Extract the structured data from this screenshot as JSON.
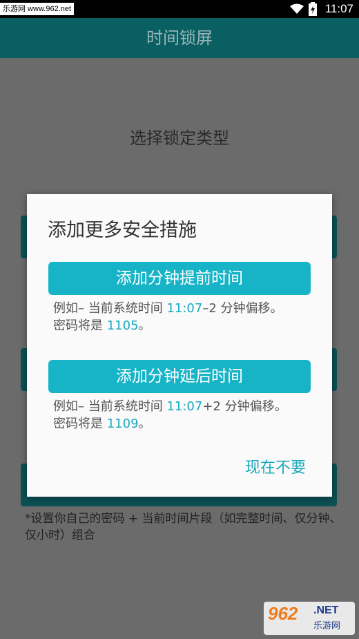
{
  "status_bar": {
    "watermark": "乐游网 www.962.net",
    "time": "11:07"
  },
  "app_bar": {
    "title": "时间锁屏"
  },
  "screen": {
    "title": "选择锁定类型",
    "footnote": "*设置你自己的密码 + 当前时间片段（如完整时间、仅分钟、仅小时）组合"
  },
  "dialog": {
    "title": "添加更多安全措施",
    "option1": {
      "button": "添加分钟提前时间",
      "desc_a": "例如– 当前系统时间 ",
      "desc_time": "11:07",
      "desc_b": "–2 分钟偏移。密码将是 ",
      "desc_code": "1105",
      "desc_c": "。"
    },
    "option2": {
      "button": "添加分钟延后时间",
      "desc_a": "例如– 当前系统时间 ",
      "desc_time": "11:07",
      "desc_b": "+2 分钟偏移。密码将是 ",
      "desc_code": "1109",
      "desc_c": "。"
    },
    "dismiss": "现在不要"
  },
  "logo": {
    "number": "962",
    "net": ".NET",
    "site": "乐游网"
  },
  "colors": {
    "accent": "#17b4c8",
    "app_bar": "#0a5f63",
    "scrim": "#6b6b6b"
  }
}
